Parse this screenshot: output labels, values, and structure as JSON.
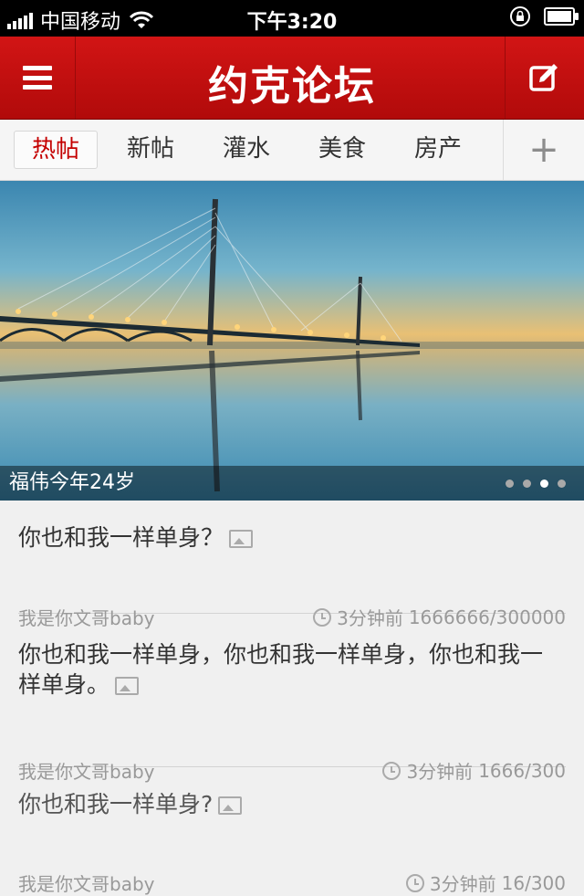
{
  "status_bar": {
    "carrier": "中国移动",
    "time": "下午3:20"
  },
  "header": {
    "title": "约克论坛"
  },
  "tabs": [
    {
      "label": "热帖",
      "active": true
    },
    {
      "label": "新帖"
    },
    {
      "label": "灌水"
    },
    {
      "label": "美食"
    },
    {
      "label": "房产"
    }
  ],
  "add_tab_symbol": "+",
  "banner": {
    "caption": "福伟今年24岁",
    "pages": 4,
    "active_page": 3
  },
  "posts": [
    {
      "title": "你也和我一样单身？",
      "author": "我是你文哥baby",
      "time": "3分钟前",
      "stats": "1666666/300000"
    },
    {
      "title": "你也和我一样单身，你也和我一样单身，你也和我一样单身。",
      "author": "我是你文哥baby",
      "time": "3分钟前",
      "stats": "1666/300"
    },
    {
      "title": "你也和我一样单身?",
      "author": "我是你文哥baby",
      "time": "3分钟前",
      "stats": "16/300"
    }
  ],
  "colors": {
    "brand_red": "#c40000",
    "header_red": "#d21515",
    "text_gray": "#999999"
  }
}
